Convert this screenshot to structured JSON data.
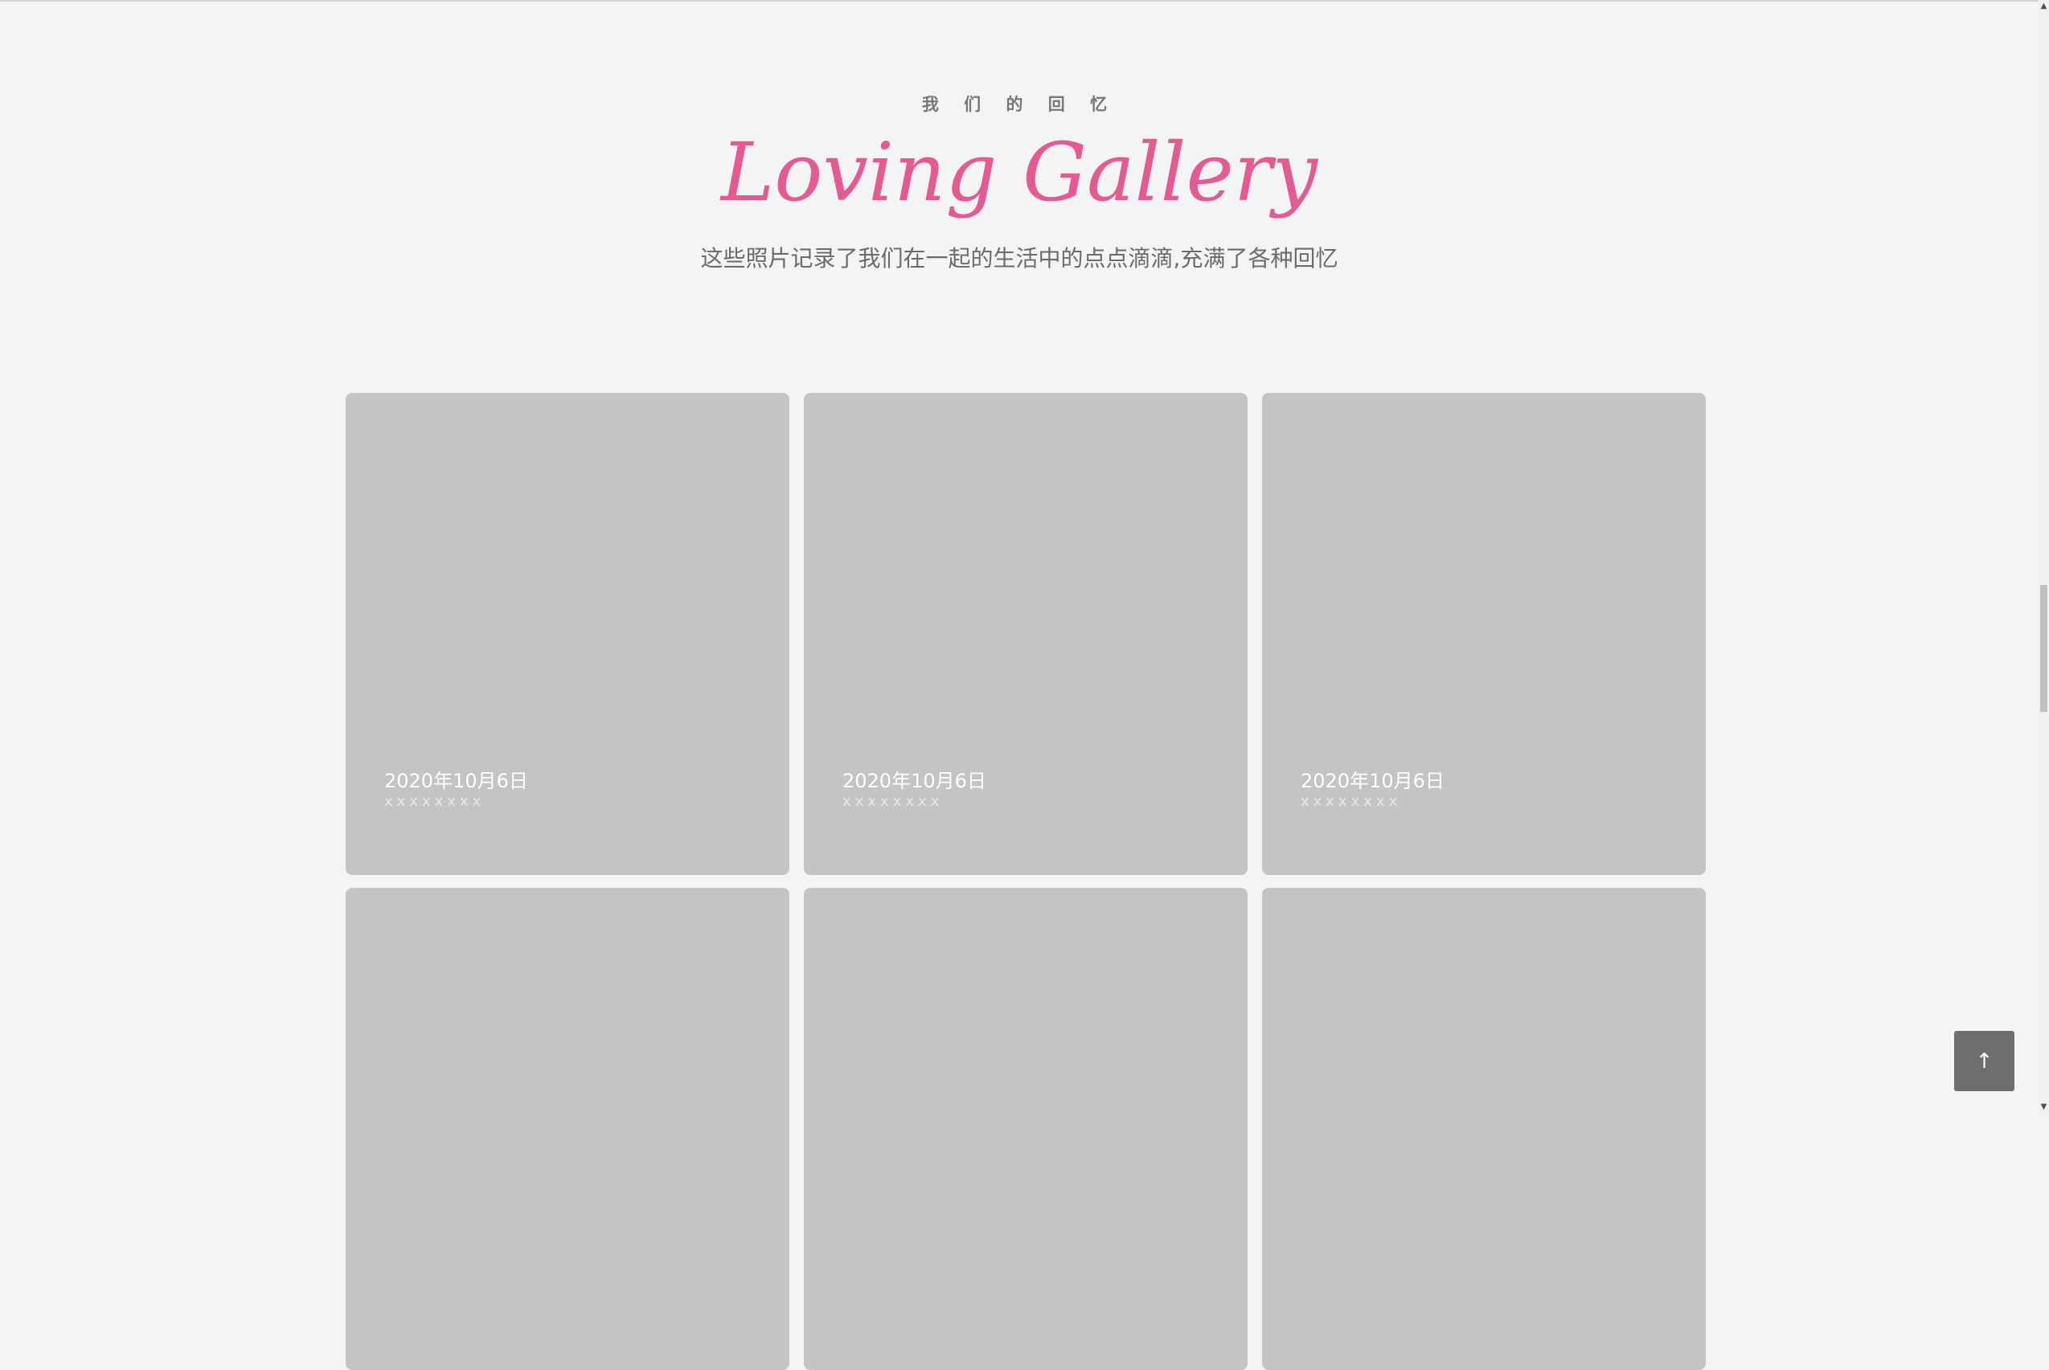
{
  "header": {
    "kicker": "我 们 的 回 忆",
    "title": "Loving Gallery",
    "subtitle": "这些照片记录了我们在一起的生活中的点点滴滴,充满了各种回忆"
  },
  "cards": [
    {
      "date": "2020年10月6日",
      "desc": "xxxxxxxx"
    },
    {
      "date": "2020年10月6日",
      "desc": "xxxxxxxx"
    },
    {
      "date": "2020年10月6日",
      "desc": "xxxxxxxx"
    },
    {
      "date": "",
      "desc": ""
    },
    {
      "date": "",
      "desc": ""
    },
    {
      "date": "",
      "desc": ""
    }
  ],
  "back_to_top": {
    "icon": "arrow-up-icon",
    "glyph": "↑"
  },
  "scrollbar": {
    "up_glyph": "▲",
    "down_glyph": "▼"
  },
  "colors": {
    "accent": "#e45a93",
    "card": "#c4c4c4",
    "background": "#f4f4f4"
  }
}
